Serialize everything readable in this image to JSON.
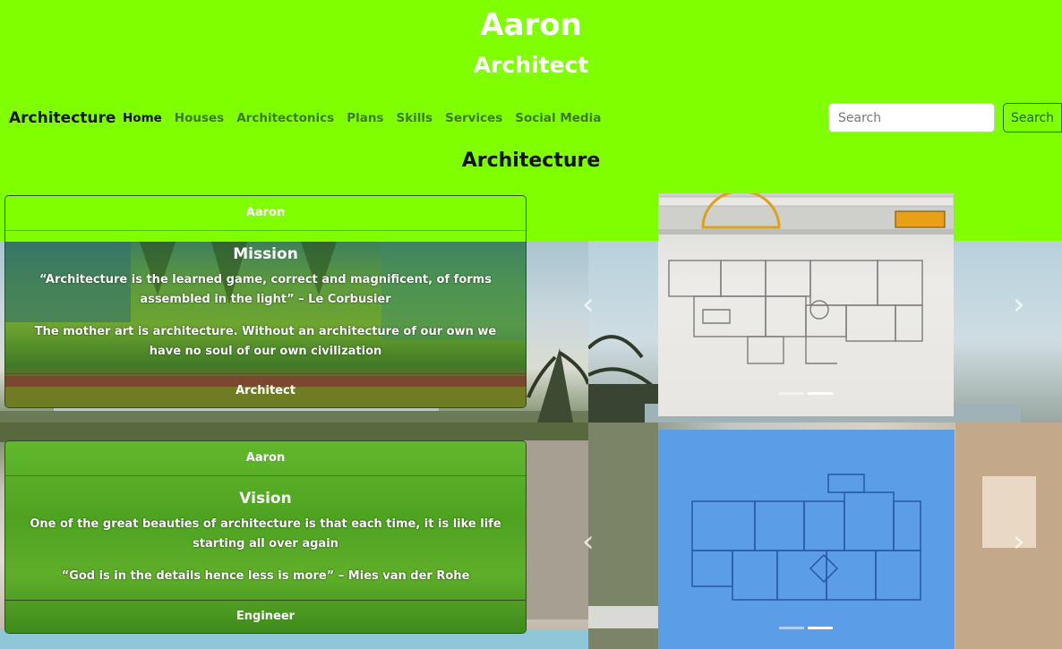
{
  "header": {
    "name": "Aaron",
    "role": "Architect"
  },
  "navbar": {
    "brand": "Architecture",
    "links": [
      "Home",
      "Houses",
      "Architectonics",
      "Plans",
      "Skills",
      "Services",
      "Social Media"
    ],
    "active": "Home",
    "search_placeholder": "Search",
    "search_button": "Search"
  },
  "section_title": "Architecture",
  "cards": [
    {
      "header": "Aaron",
      "title": "Mission",
      "paragraphs": [
        "“Architecture is the learned game, correct and magnificent, of forms assembled in the light” – Le Corbusier",
        "The mother art is architecture. Without an architecture of our own we have no soul of our own civilization"
      ],
      "footer": "Architect"
    },
    {
      "header": "Aaron",
      "title": "Vision",
      "paragraphs": [
        "One of the great beauties of architecture is that each time, it is like life starting all over again",
        "“God is in the details hence less is more” – Mies van der Rohe"
      ],
      "footer": "Engineer"
    }
  ],
  "carousel": {
    "prev_icon": "‹",
    "next_icon": "›",
    "slide_count": 2,
    "active_slide": 2
  },
  "colors": {
    "accent": "#80ff00"
  }
}
